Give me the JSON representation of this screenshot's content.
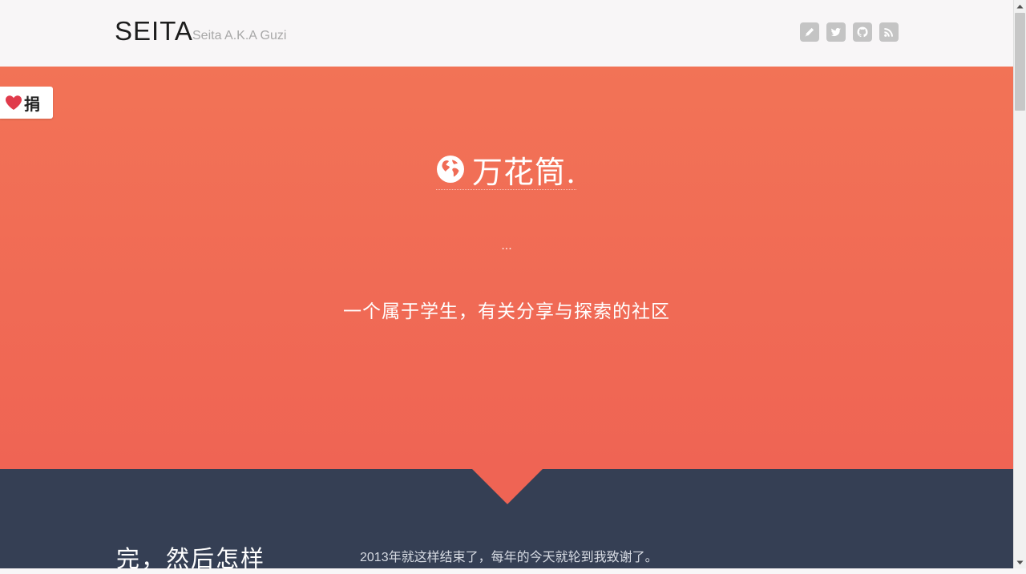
{
  "header": {
    "brand": "SEITA",
    "tagline": "Seita A.K.A Guzi",
    "social_icons": [
      "pencil-icon",
      "twitter-icon",
      "github-icon",
      "rss-icon"
    ]
  },
  "donate": {
    "label": "捐",
    "icon": "heart-icon"
  },
  "hero": {
    "title": "万花筒.",
    "ellipsis": "...",
    "subtitle": "一个属于学生，有关分享与探索的社区"
  },
  "section": {
    "title": "完，然后怎样",
    "text": "2013年就这样结束了，每年的今天就轮到我致谢了。"
  },
  "colors": {
    "hero_top": "#f27356",
    "hero_bottom": "#ef6454",
    "dark": "#353f54",
    "icon_gray": "#c4c4c4"
  }
}
